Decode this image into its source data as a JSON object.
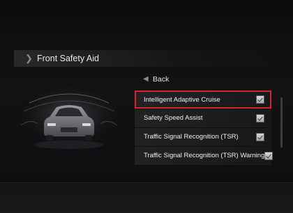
{
  "header": {
    "title": "Front Safety Aid"
  },
  "menu": {
    "back_label": "Back",
    "items": [
      {
        "label": "Intelligent Adaptive Cruise",
        "checked": true,
        "selected": true
      },
      {
        "label": "Safety Speed Assist",
        "checked": true,
        "selected": false
      },
      {
        "label": "Traffic Signal Recognition (TSR)",
        "checked": true,
        "selected": false
      },
      {
        "label": "Traffic Signal Recognition (TSR) Warning",
        "checked": true,
        "selected": false
      }
    ]
  },
  "icons": {
    "title": "chevron-right-icon",
    "back": "chevron-left-icon",
    "check": "checkbox-checked-icon",
    "illustration": "car-sensor-illustration"
  },
  "colors": {
    "selection_border": "#d8232a",
    "background": "#0d0d0e"
  }
}
